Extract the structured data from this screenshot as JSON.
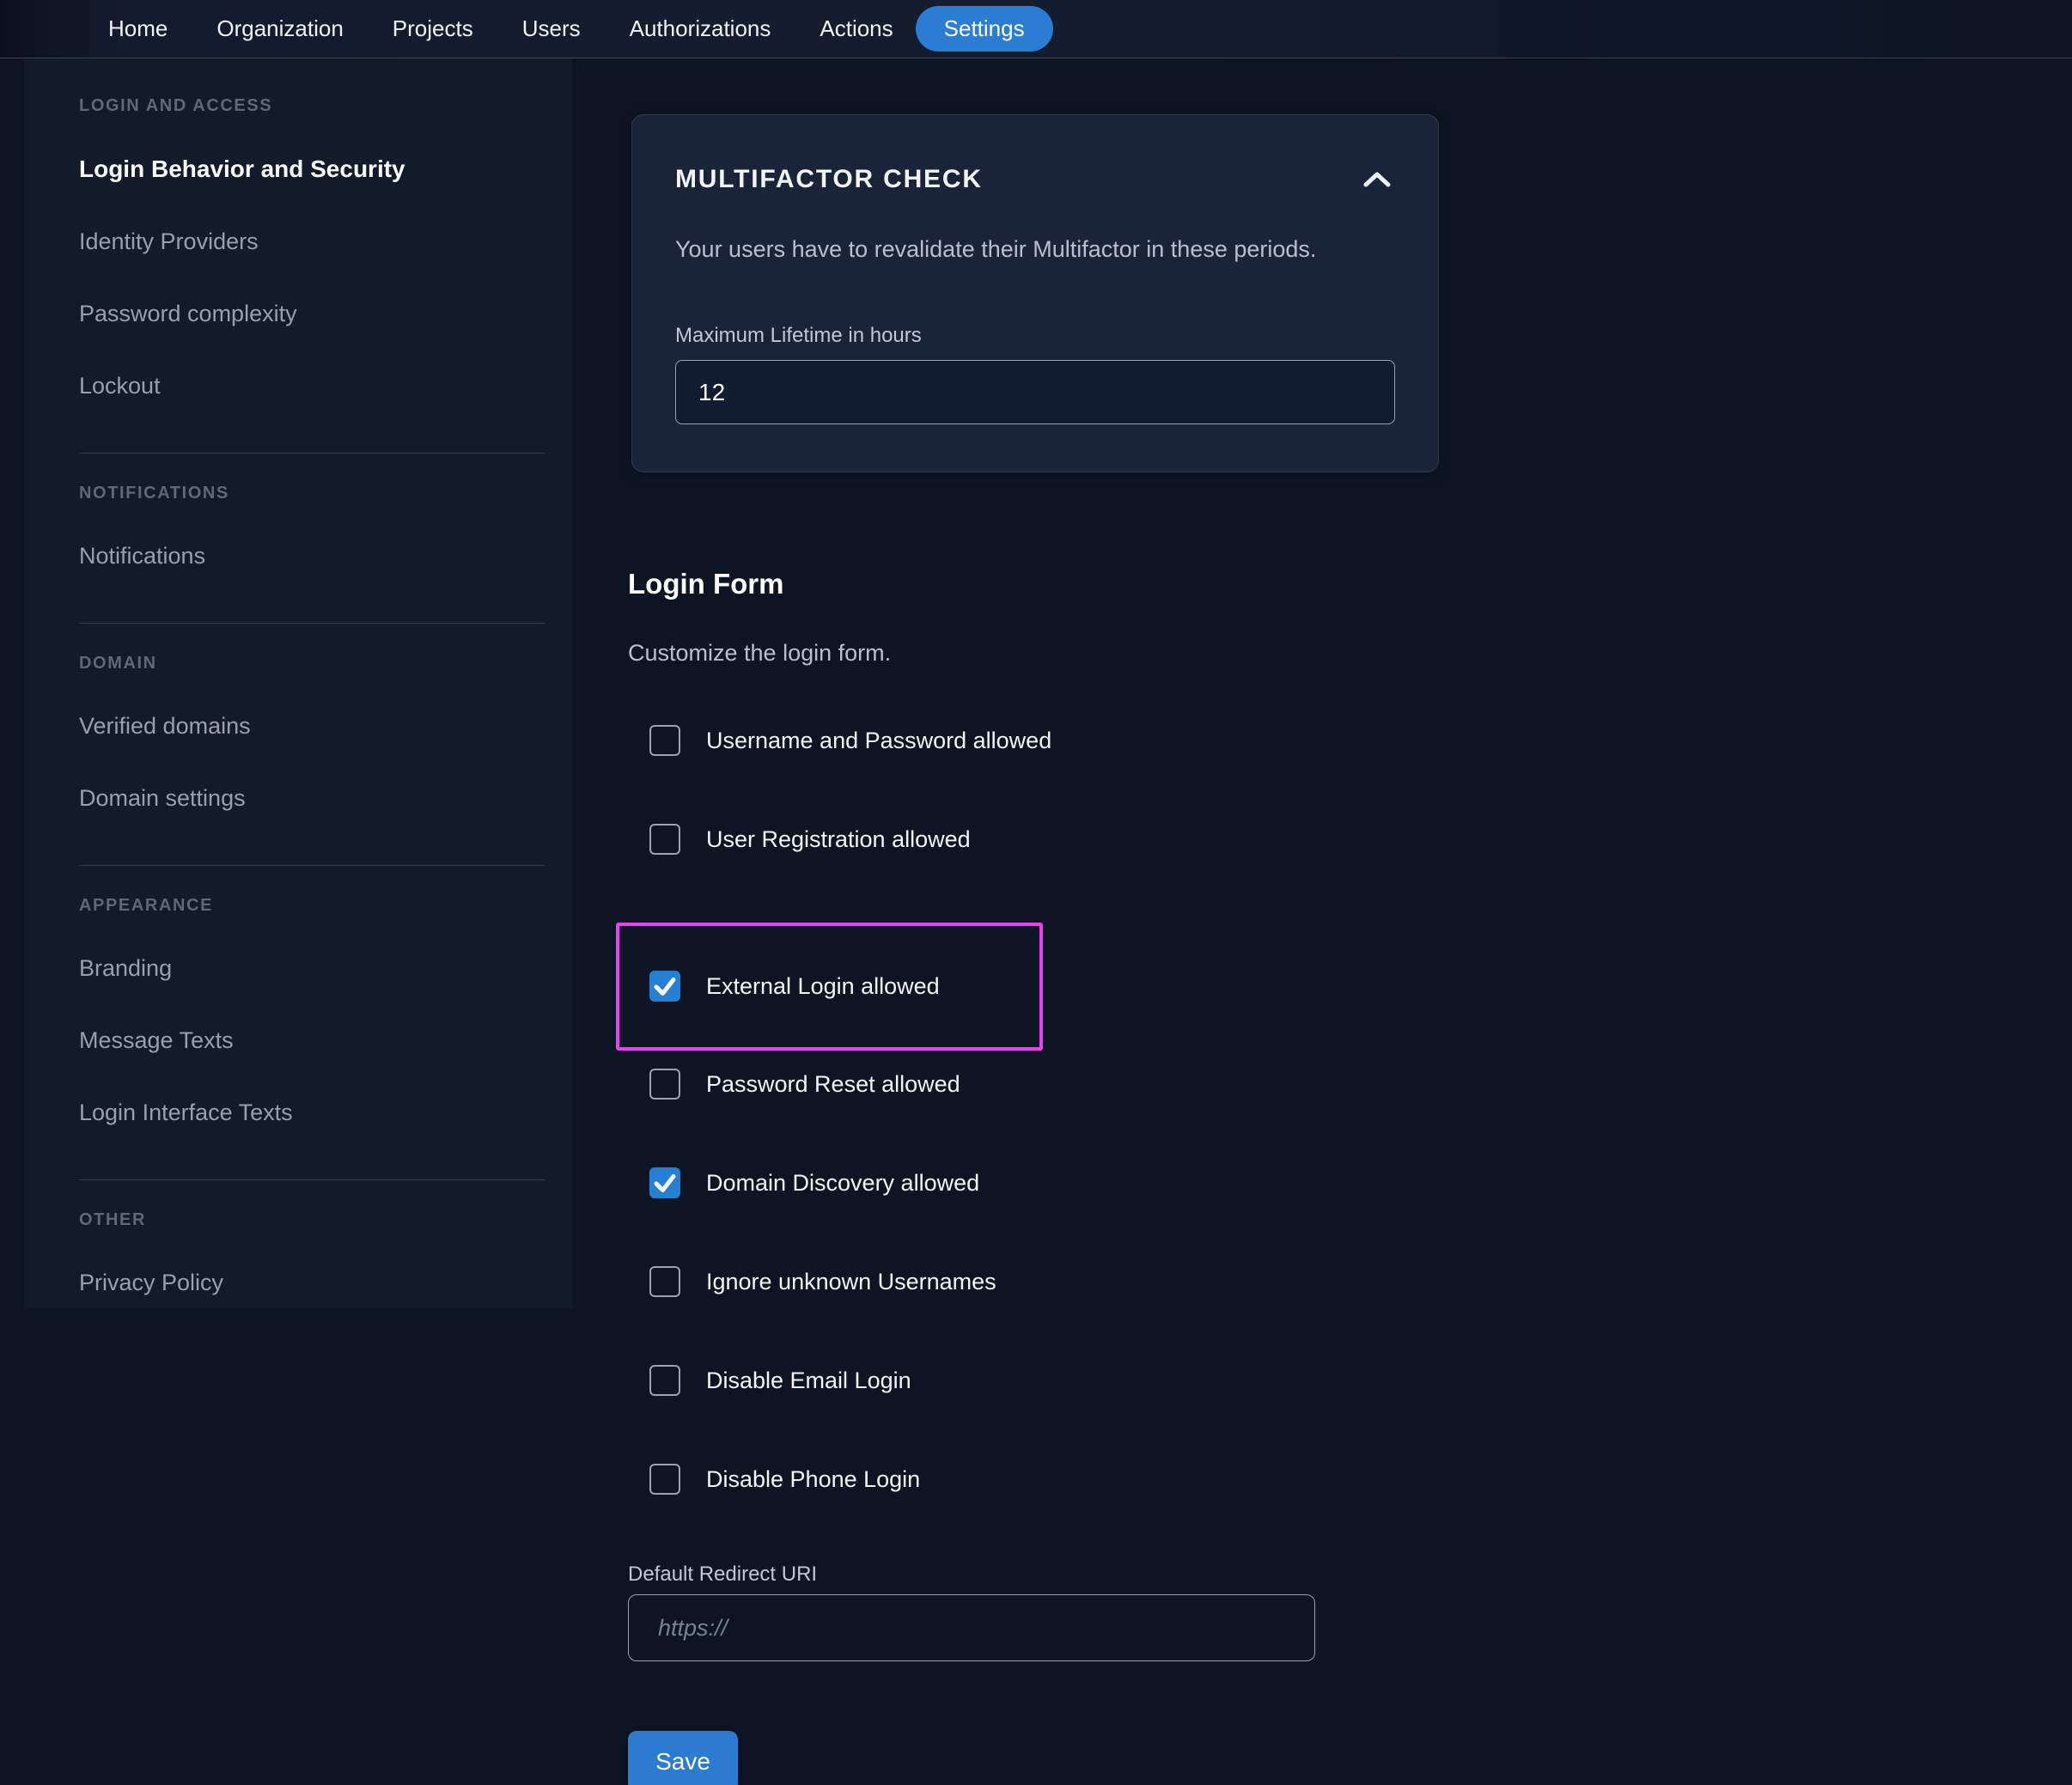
{
  "nav": {
    "items": [
      {
        "label": "Home",
        "active": false
      },
      {
        "label": "Organization",
        "active": false
      },
      {
        "label": "Projects",
        "active": false
      },
      {
        "label": "Users",
        "active": false
      },
      {
        "label": "Authorizations",
        "active": false
      },
      {
        "label": "Actions",
        "active": false
      },
      {
        "label": "Settings",
        "active": true
      }
    ]
  },
  "sidebar": {
    "sections": [
      {
        "header": "LOGIN AND ACCESS",
        "items": [
          {
            "label": "Login Behavior and Security",
            "active": true
          },
          {
            "label": "Identity Providers",
            "active": false
          },
          {
            "label": "Password complexity",
            "active": false
          },
          {
            "label": "Lockout",
            "active": false
          }
        ]
      },
      {
        "header": "NOTIFICATIONS",
        "items": [
          {
            "label": "Notifications",
            "active": false
          }
        ]
      },
      {
        "header": "DOMAIN",
        "items": [
          {
            "label": "Verified domains",
            "active": false
          },
          {
            "label": "Domain settings",
            "active": false
          }
        ]
      },
      {
        "header": "APPEARANCE",
        "items": [
          {
            "label": "Branding",
            "active": false
          },
          {
            "label": "Message Texts",
            "active": false
          },
          {
            "label": "Login Interface Texts",
            "active": false
          }
        ]
      },
      {
        "header": "OTHER",
        "items": [
          {
            "label": "Privacy Policy",
            "active": false
          }
        ]
      }
    ]
  },
  "mfa_card": {
    "title": "MULTIFACTOR CHECK",
    "description": "Your users have to revalidate their Multifactor in these periods.",
    "field_label": "Maximum Lifetime in hours",
    "field_value": "12",
    "collapse_icon": "chevron-up-icon"
  },
  "login_form": {
    "title": "Login Form",
    "subtitle": "Customize the login form.",
    "checkboxes": [
      {
        "label": "Username and Password allowed",
        "checked": false,
        "highlighted": false
      },
      {
        "label": "User Registration allowed",
        "checked": false,
        "highlighted": false
      },
      {
        "label": "External Login allowed",
        "checked": true,
        "highlighted": true
      },
      {
        "label": "Password Reset allowed",
        "checked": false,
        "highlighted": false
      },
      {
        "label": "Domain Discovery allowed",
        "checked": true,
        "highlighted": false
      },
      {
        "label": "Ignore unknown Usernames",
        "checked": false,
        "highlighted": false
      },
      {
        "label": "Disable Email Login",
        "checked": false,
        "highlighted": false
      },
      {
        "label": "Disable Phone Login",
        "checked": false,
        "highlighted": false
      }
    ],
    "redirect": {
      "label": "Default Redirect URI",
      "placeholder": "https://",
      "value": ""
    },
    "save_label": "Save"
  },
  "colors": {
    "accent_blue": "#2b7dd4",
    "checkbox_blue": "#2580d3",
    "highlight_magenta": "#ea3ff2",
    "page_background": "#0d1524",
    "sidebar_background": "#121b2a",
    "card_background": "#1a2439"
  }
}
